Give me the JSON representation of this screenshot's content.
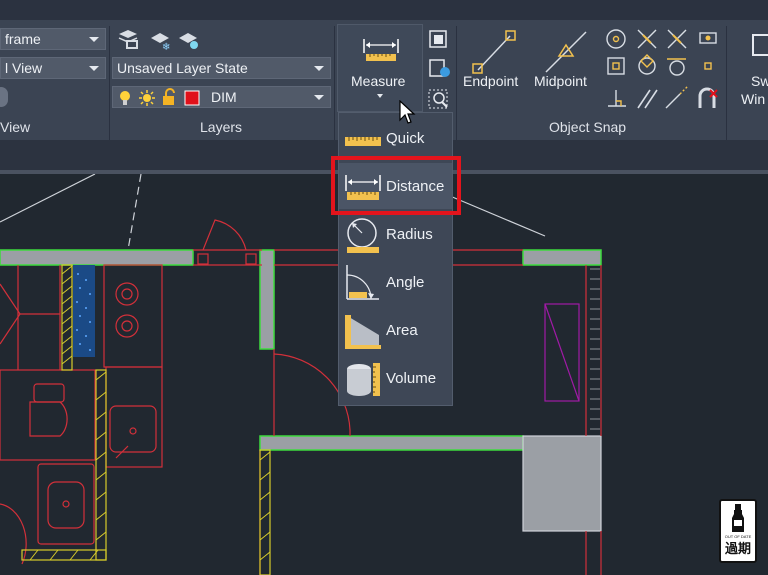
{
  "ribbon": {
    "view_panel": {
      "visual_style": "frame",
      "view": "l View",
      "label": "View"
    },
    "layers_panel": {
      "layer_state": "Unsaved Layer State",
      "current_layer": "DIM",
      "layer_color": "#e0101a",
      "label": "Layers"
    },
    "measure_button": {
      "label": "Measure"
    },
    "object_snap_panel": {
      "endpoint_label": "Endpoint",
      "midpoint_label": "Midpoint",
      "label": "Object Snap"
    },
    "partial_button": {
      "line1": "Sw",
      "line2": "Win"
    }
  },
  "measure_menu": {
    "items": [
      {
        "label": "Quick",
        "icon": "ruler-icon"
      },
      {
        "label": "Distance",
        "icon": "distance-icon"
      },
      {
        "label": "Radius",
        "icon": "radius-icon"
      },
      {
        "label": "Angle",
        "icon": "angle-icon"
      },
      {
        "label": "Area",
        "icon": "area-icon"
      },
      {
        "label": "Volume",
        "icon": "volume-icon"
      }
    ],
    "highlighted_item": "Distance",
    "highlight_color": "#e3141c"
  },
  "badge": {
    "small_text": "OUT OF DATE",
    "text": "過期"
  }
}
